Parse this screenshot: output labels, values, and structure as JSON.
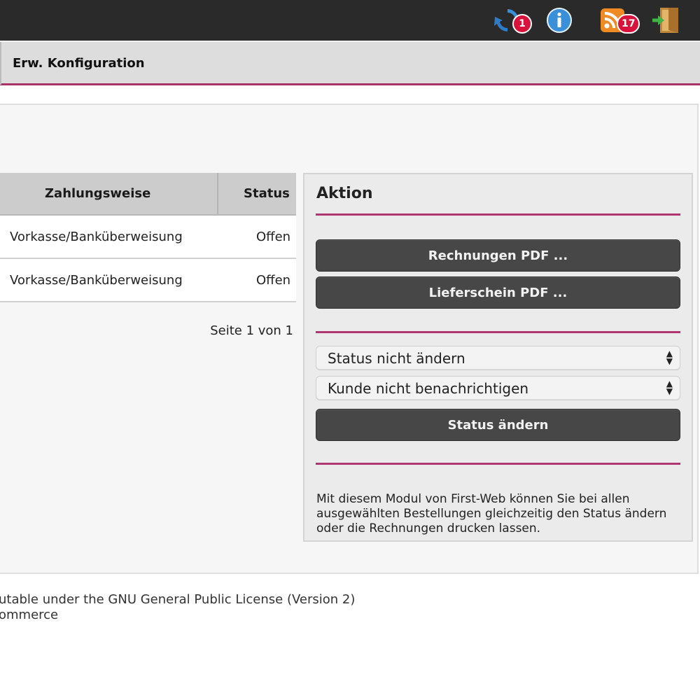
{
  "topbar": {
    "icons": [
      {
        "name": "sync-icon",
        "badge": "1",
        "color": "#3a8fd9"
      },
      {
        "name": "info-icon",
        "color": "#3a8fd9"
      },
      {
        "name": "rss-icon",
        "badge": "17",
        "color": "#f08a24"
      },
      {
        "name": "logout-icon",
        "color": "#c08a3a"
      }
    ]
  },
  "menu": {
    "active_label": "Erw. Konfiguration"
  },
  "orders_table": {
    "columns": [
      "Zahlungsweise",
      "Status"
    ],
    "rows": [
      {
        "payment": "Vorkasse/Banküberweisung",
        "status": "Offen"
      },
      {
        "payment": "Vorkasse/Banküberweisung",
        "status": "Offen"
      }
    ],
    "pager": "Seite 1 von 1"
  },
  "action_panel": {
    "title": "Aktion",
    "invoice_pdf_button": "Rechnungen PDF ...",
    "delivery_pdf_button": "Lieferschein PDF ...",
    "status_select": "Status nicht ändern",
    "notify_select": "Kunde nicht benachrichtigen",
    "change_status_button": "Status ändern",
    "info_text": "Mit diesem Modul von First-Web können Sie bei allen ausgewählten Bestellungen gleichzeitig den Status ändern oder die Rechnungen drucken lassen."
  },
  "footer": {
    "line1": "utable under the GNU General Public License (Version 2)",
    "line2": "ommerce"
  },
  "colors": {
    "accent": "#b03672",
    "topbar": "#2a2a2a",
    "button": "#474747",
    "badge": "#d8123a"
  }
}
